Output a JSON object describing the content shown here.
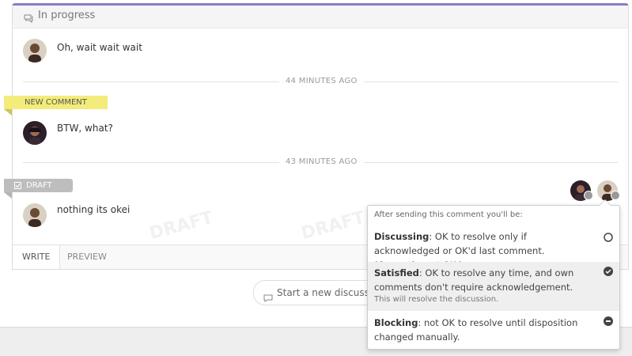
{
  "panel": {
    "status": "In progress"
  },
  "comments": [
    {
      "text": "Oh, wait wait wait"
    },
    {
      "text": "BTW, what?"
    },
    {
      "text": "nothing its okei"
    }
  ],
  "separators": [
    "44 MINUTES AGO",
    "43 MINUTES AGO"
  ],
  "ribbons": {
    "new_comment": "NEW COMMENT",
    "draft": "DRAFT"
  },
  "watermark": "DRAFT",
  "tabs": {
    "write": "WRITE",
    "preview": "PREVIEW"
  },
  "discussion_button": "Start a new discussion",
  "popover": {
    "header": "After sending this comment you'll be:",
    "options": [
      {
        "title": "Discussing",
        "desc": ": OK to resolve only if acknowledged or OK'd last comment. (Currently: not OK.)",
        "note": "",
        "state": "unchecked"
      },
      {
        "title": "Satisfied",
        "desc": ": OK to resolve any time, and own comments don't require acknowledgement.",
        "note": "This will resolve the discussion.",
        "state": "checked"
      },
      {
        "title": "Blocking",
        "desc": ": not OK to resolve until disposition changed manually.",
        "note": "",
        "state": "minus"
      }
    ]
  },
  "colors": {
    "accent": "#8c7ac6",
    "new_ribbon": "#f3ec7a",
    "draft_ribbon": "#bdbdbd"
  }
}
